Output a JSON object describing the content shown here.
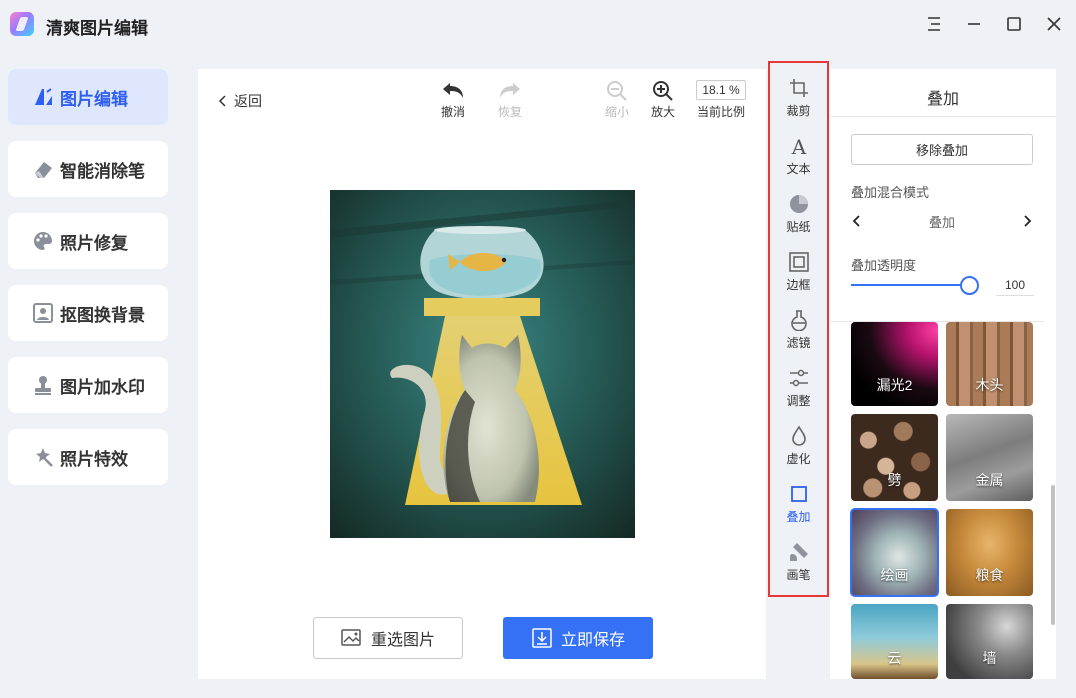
{
  "app": {
    "title": "清爽图片编辑"
  },
  "sidebar": {
    "items": [
      {
        "label": "图片编辑",
        "icon": "image-edit-icon",
        "active": true
      },
      {
        "label": "智能消除笔",
        "icon": "eraser-icon"
      },
      {
        "label": "照片修复",
        "icon": "palette-icon"
      },
      {
        "label": "抠图换背景",
        "icon": "portrait-icon"
      },
      {
        "label": "图片加水印",
        "icon": "stamp-icon"
      },
      {
        "label": "照片特效",
        "icon": "magic-wand-icon"
      }
    ]
  },
  "toolbar": {
    "back": "返回",
    "undo": "撤消",
    "redo": "恢复",
    "zoom_out": "缩小",
    "zoom_in": "放大",
    "zoom_value": "18.1 %",
    "ratio_label": "当前比例"
  },
  "actions": {
    "reselect": "重选图片",
    "save": "立即保存"
  },
  "vtools": [
    {
      "label": "裁剪",
      "icon": "crop-icon"
    },
    {
      "label": "文本",
      "icon": "text-icon"
    },
    {
      "label": "贴纸",
      "icon": "sticker-icon"
    },
    {
      "label": "边框",
      "icon": "frame-icon"
    },
    {
      "label": "滤镜",
      "icon": "filter-icon"
    },
    {
      "label": "调整",
      "icon": "adjust-icon"
    },
    {
      "label": "虚化",
      "icon": "blur-icon"
    },
    {
      "label": "叠加",
      "icon": "overlay-icon",
      "active": true
    },
    {
      "label": "画笔",
      "icon": "brush-icon"
    }
  ],
  "panel": {
    "title": "叠加",
    "remove_label": "移除叠加",
    "blend_label": "叠加混合模式",
    "blend_value": "叠加",
    "opacity_label": "叠加透明度",
    "opacity_value": "100",
    "opacity_level": 1.0,
    "overlays": [
      {
        "label": "漏光2"
      },
      {
        "label": "木头"
      },
      {
        "label": "劈"
      },
      {
        "label": "金属"
      },
      {
        "label": "绘画",
        "selected": true
      },
      {
        "label": "粮食"
      },
      {
        "label": "云"
      },
      {
        "label": "墙"
      }
    ]
  },
  "colors": {
    "accent": "#3571f4",
    "highlight_border": "#e53935",
    "active_bg": "#dfe7ff"
  }
}
